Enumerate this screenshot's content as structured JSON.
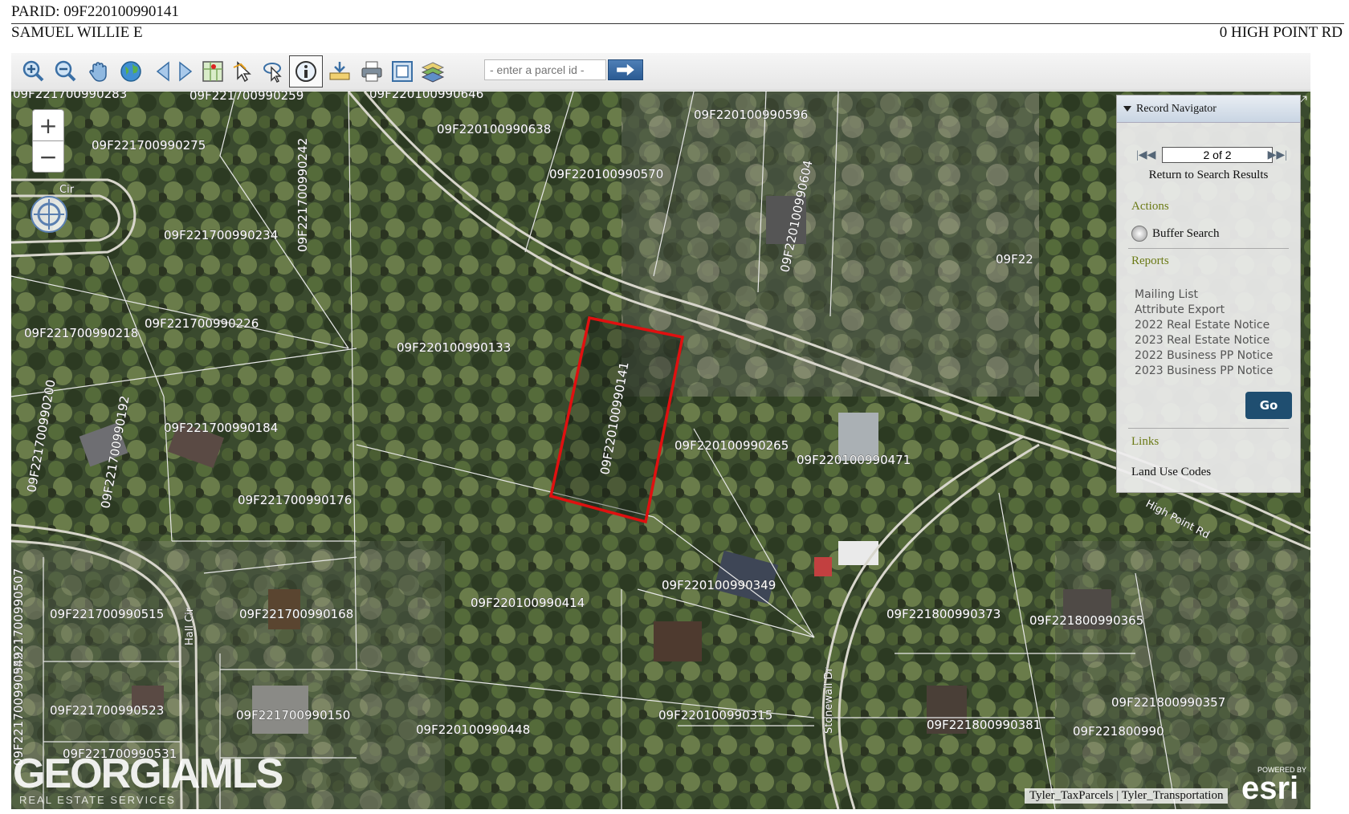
{
  "header": {
    "parid": "PARID: 09F220100990141",
    "owner": "SAMUEL WILLIE E",
    "address": "0 HIGH POINT RD"
  },
  "toolbar": {
    "tools": [
      {
        "icon": "zoom-in-icon",
        "active": false
      },
      {
        "icon": "zoom-out-icon",
        "active": false
      },
      {
        "icon": "pan-hand-icon",
        "active": false
      },
      {
        "icon": "full-extent-globe-icon",
        "active": false
      },
      {
        "icon": "previous-extent-icon",
        "active": false
      },
      {
        "icon": "next-extent-icon",
        "active": false
      },
      {
        "icon": "map-select-icon",
        "active": false
      },
      {
        "icon": "select-pointer-icon",
        "active": false
      },
      {
        "icon": "select-lasso-icon",
        "active": false
      },
      {
        "icon": "identify-info-icon",
        "active": true
      },
      {
        "icon": "measure-icon",
        "active": false
      },
      {
        "icon": "print-icon",
        "active": false
      },
      {
        "icon": "fit-extent-icon",
        "active": false
      },
      {
        "icon": "layers-icon",
        "active": false
      }
    ],
    "parcel_placeholder": "- enter a parcel id -"
  },
  "map": {
    "parcel_labels": [
      "09F221700990283",
      "09F221700990259",
      "09F220100990646",
      "09F220100990596",
      "09F220100990638",
      "09F221700990275",
      "09F221700990242",
      "09F220100990570",
      "09F220100990604",
      "09F221700990234",
      "09F220100990133",
      "09F221700990218",
      "09F221700990226",
      "09F220100990141",
      "09F221700990200",
      "09F221700990192",
      "09F221700990184",
      "09F220100990265",
      "09F220100990471",
      "09F221700990176",
      "09F220100990349",
      "09F221700990507",
      "09F221700990515",
      "09F221700990168",
      "09F220100990414",
      "09F221800990373",
      "09F221800990365",
      "09F221700990549",
      "09F221700990523",
      "09F221700990150",
      "09F220100990315",
      "09F220100990448",
      "09F221800990381",
      "09F221800990357",
      "09F221800990",
      "09F221700990531"
    ],
    "partial_label": "09F22",
    "road_labels": [
      "Hall Cir",
      "Stonewall Dr",
      "High Point Rd",
      "Cir"
    ],
    "attribution": "Tyler_TaxParcels | Tyler_Transportation",
    "esri_powered": "POWERED BY",
    "esri_logo": "esri",
    "watermark": "GEORGIAMLS",
    "watermark_sub": "REAL ESTATE SERVICES"
  },
  "panel": {
    "title": "Record Navigator",
    "record_count": "2 of 2",
    "return_link": "Return to Search Results",
    "actions_heading": "Actions",
    "buffer_search": "Buffer Search",
    "reports_heading": "Reports",
    "reports": [
      "Mailing List",
      "Attribute Export",
      "2022 Real Estate Notice",
      "2023 Real Estate Notice",
      "2022 Business PP Notice",
      "2023 Business PP Notice"
    ],
    "go_label": "Go",
    "links_heading": "Links",
    "land_use_link": "Land Use Codes"
  },
  "colors": {
    "selected_parcel": "#e01010",
    "panel_heading": "#6b7a15",
    "go_button": "#1f4e70"
  }
}
